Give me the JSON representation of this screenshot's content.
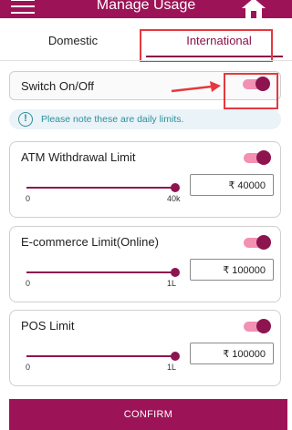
{
  "header": {
    "title": "Manage Usage"
  },
  "tabs": [
    {
      "label": "Domestic"
    },
    {
      "label": "International"
    }
  ],
  "master_switch": {
    "label": "Switch On/Off",
    "enabled": true
  },
  "notice": {
    "text": "Please note these are daily limits."
  },
  "limits": [
    {
      "title": "ATM Withdrawal Limit",
      "enabled": true,
      "min_label": "0",
      "max_label": "40k",
      "value": "₹ 40000",
      "slider_fraction": 1.0
    },
    {
      "title": "E-commerce Limit(Online)",
      "enabled": true,
      "min_label": "0",
      "max_label": "1L",
      "value": "₹ 100000",
      "slider_fraction": 1.0
    },
    {
      "title": "POS Limit",
      "enabled": true,
      "min_label": "0",
      "max_label": "1L",
      "value": "₹ 100000",
      "slider_fraction": 1.0
    }
  ],
  "confirm": {
    "label": "CONFIRM"
  },
  "colors": {
    "brand": "#9c1457",
    "toggle_track": "#f291b4",
    "annotation": "#e4393f",
    "notice": "#2e8f9d"
  }
}
